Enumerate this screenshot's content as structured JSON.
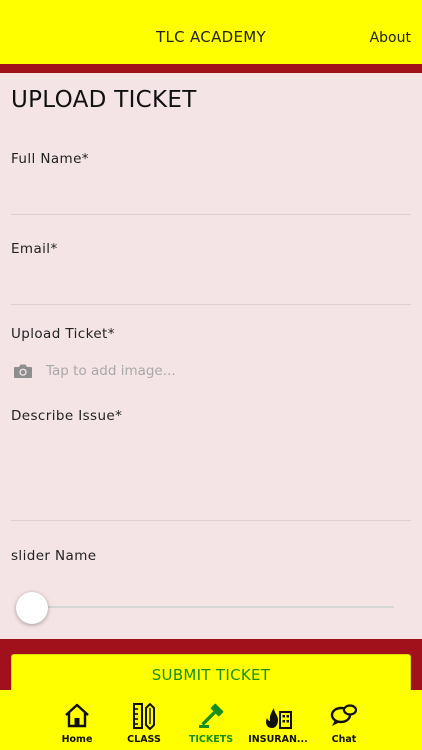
{
  "header": {
    "title": "TLC ACADEMY",
    "about_label": "About"
  },
  "page": {
    "title": "UPLOAD TICKET"
  },
  "form": {
    "full_name_label": "Full Name*",
    "email_label": "Email*",
    "upload_label": "Upload Ticket*",
    "upload_placeholder": "Tap to add image...",
    "describe_label": "Describe Issue*",
    "slider_label": "slider Name",
    "slider_value": 0,
    "submit_label": "SUBMIT TICKET"
  },
  "tabs": [
    {
      "label": "Home",
      "icon": "home-icon"
    },
    {
      "label": "CLASS",
      "icon": "ruler-pencil-icon"
    },
    {
      "label": "TICKETS",
      "icon": "gavel-icon",
      "active": true
    },
    {
      "label": "INSURAN...",
      "icon": "fire-building-icon"
    },
    {
      "label": "Chat",
      "icon": "chat-bubbles-icon"
    }
  ],
  "colors": {
    "accent_yellow": "#ffff00",
    "band_red": "#a1111b",
    "active_green": "#1a8d1a",
    "background": "#f5e4e6"
  }
}
